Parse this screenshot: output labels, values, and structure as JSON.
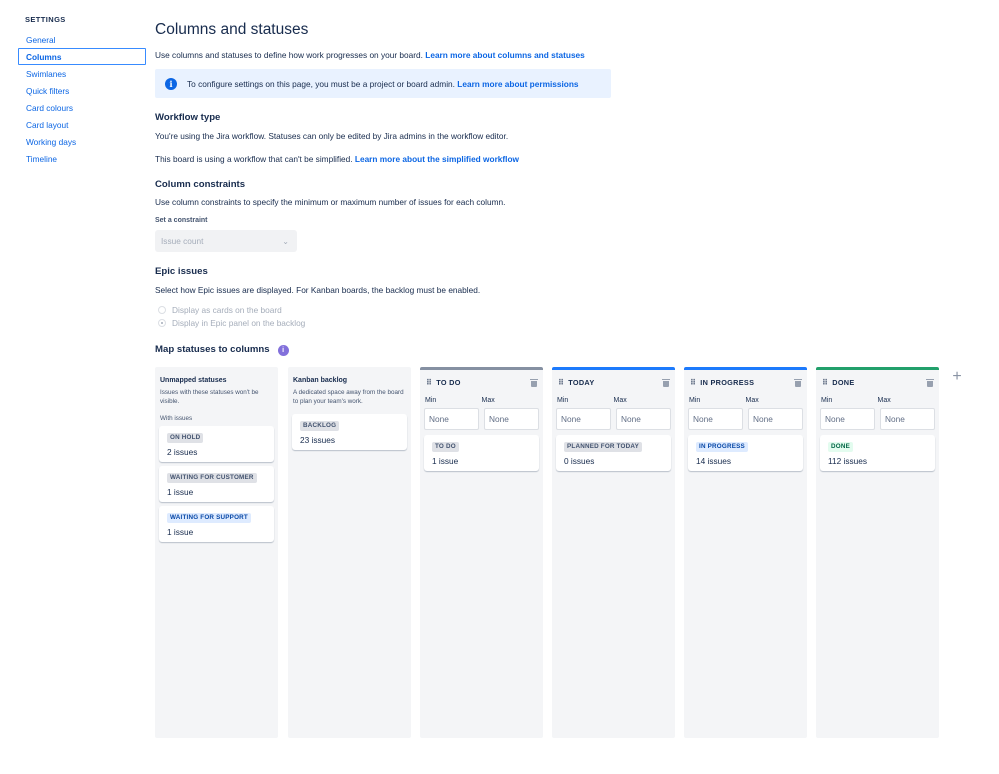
{
  "sidebar": {
    "title": "SETTINGS",
    "items": [
      {
        "label": "General"
      },
      {
        "label": "Columns"
      },
      {
        "label": "Swimlanes"
      },
      {
        "label": "Quick filters"
      },
      {
        "label": "Card colours"
      },
      {
        "label": "Card layout"
      },
      {
        "label": "Working days"
      },
      {
        "label": "Timeline"
      }
    ]
  },
  "page": {
    "title": "Columns and statuses",
    "intro_text": "Use columns and statuses to define how work progresses on your board.",
    "intro_link": "Learn more about columns and statuses"
  },
  "banner": {
    "icon": "info-icon",
    "text": "To configure settings on this page, you must be a project or board admin.",
    "link": "Learn more about permissions"
  },
  "workflow": {
    "title": "Workflow type",
    "line1": "You're using the Jira workflow. Statuses can only be edited by Jira admins in the workflow editor.",
    "line2": "This board is using a workflow that can't be simplified.",
    "line2_link": "Learn more about the simplified workflow"
  },
  "constraints": {
    "title": "Column constraints",
    "desc": "Use column constraints to specify the minimum or maximum number of issues for each column.",
    "label": "Set a constraint",
    "value": "Issue count"
  },
  "epic": {
    "title": "Epic issues",
    "desc": "Select how Epic issues are displayed. For Kanban boards, the backlog must be enabled.",
    "option1": "Display as cards on the board",
    "option2": "Display in Epic panel on the backlog"
  },
  "map": {
    "title": "Map statuses to columns",
    "icon": "discovery-icon"
  },
  "unmapped": {
    "name": "Unmapped statuses",
    "desc": "Issues with these statuses won't be visible.",
    "with_issues": "With issues",
    "cards": [
      {
        "status": "ON HOLD",
        "count": "2 issues"
      },
      {
        "status": "WAITING FOR CUSTOMER",
        "count": "1 issue"
      },
      {
        "status": "WAITING FOR SUPPORT",
        "count": "1 issue"
      }
    ]
  },
  "backlog": {
    "name": "Kanban backlog",
    "desc": "A dedicated space away from the board to plan your team's work.",
    "card": {
      "status": "BACKLOG",
      "count": "23 issues"
    }
  },
  "columns": [
    {
      "title": "TO DO",
      "accent": "#8590a2",
      "min_label": "Min",
      "max_label": "Max",
      "min": "None",
      "max": "None",
      "card": {
        "status": "TO DO",
        "count": "1 issue"
      }
    },
    {
      "title": "TODAY",
      "accent": "#1d7afc",
      "min_label": "Min",
      "max_label": "Max",
      "min": "None",
      "max": "None",
      "card": {
        "status": "PLANNED FOR TODAY",
        "count": "0 issues"
      }
    },
    {
      "title": "IN PROGRESS",
      "accent": "#1d7afc",
      "min_label": "Min",
      "max_label": "Max",
      "min": "None",
      "max": "None",
      "card": {
        "status": "IN PROGRESS",
        "count": "14 issues"
      }
    },
    {
      "title": "DONE",
      "accent": "#22a06b",
      "min_label": "Min",
      "max_label": "Max",
      "min": "None",
      "max": "None",
      "card": {
        "status": "DONE",
        "count": "112 issues"
      }
    }
  ],
  "add_column": {
    "icon": "plus-icon",
    "glyph": "+"
  }
}
